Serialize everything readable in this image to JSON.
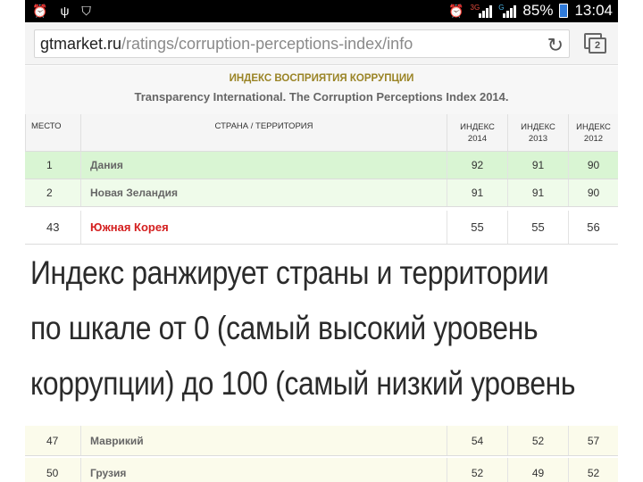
{
  "status_bar": {
    "left_icons": [
      "alarm-icon",
      "usb-icon",
      "shield-icon"
    ],
    "network_tag_1": "3G",
    "network_tag_2": "G",
    "battery": "85%",
    "time": "13:04"
  },
  "browser": {
    "url_domain": "gtmarket.ru",
    "url_path": "/ratings/corruption-perceptions-index/info",
    "tab_count": "2"
  },
  "page": {
    "title": "ИНДЕКС ВОСПРИЯТИЯ КОРРУПЦИИ",
    "subtitle": "Transparency International. The Corruption Perceptions Index 2014."
  },
  "table": {
    "headers": {
      "rank": "МЕСТО",
      "country": "СТРАНА / ТЕРРИТОРИЯ",
      "y2014_l1": "ИНДЕКС",
      "y2014_l2": "2014",
      "y2013_l1": "ИНДЕКС",
      "y2013_l2": "2013",
      "y2012_l1": "ИНДЕКС",
      "y2012_l2": "2012"
    },
    "rows": [
      {
        "rank": "1",
        "country": "Дания",
        "y2014": "92",
        "y2013": "91",
        "y2012": "90"
      },
      {
        "rank": "2",
        "country": "Новая Зеландия",
        "y2014": "91",
        "y2013": "91",
        "y2012": "90"
      },
      {
        "rank": "43",
        "country": "Южная Корея",
        "y2014": "55",
        "y2013": "55",
        "y2012": "56"
      },
      {
        "rank": "47",
        "country": "Маврикий",
        "y2014": "54",
        "y2013": "52",
        "y2012": "57"
      },
      {
        "rank": "50",
        "country": "Грузия",
        "y2014": "52",
        "y2013": "49",
        "y2012": "52"
      }
    ]
  },
  "overlay": {
    "line1": "Индекс ранжирует страны и территории",
    "line2": "по шкале от 0 (самый высокий уровень",
    "line3": "коррупции) до 100 (самый низкий уровень"
  },
  "colors": {
    "highlight_country": "#d41f1f",
    "header_title": "#9a8426",
    "top_row_bg": "#d9f5d3"
  }
}
